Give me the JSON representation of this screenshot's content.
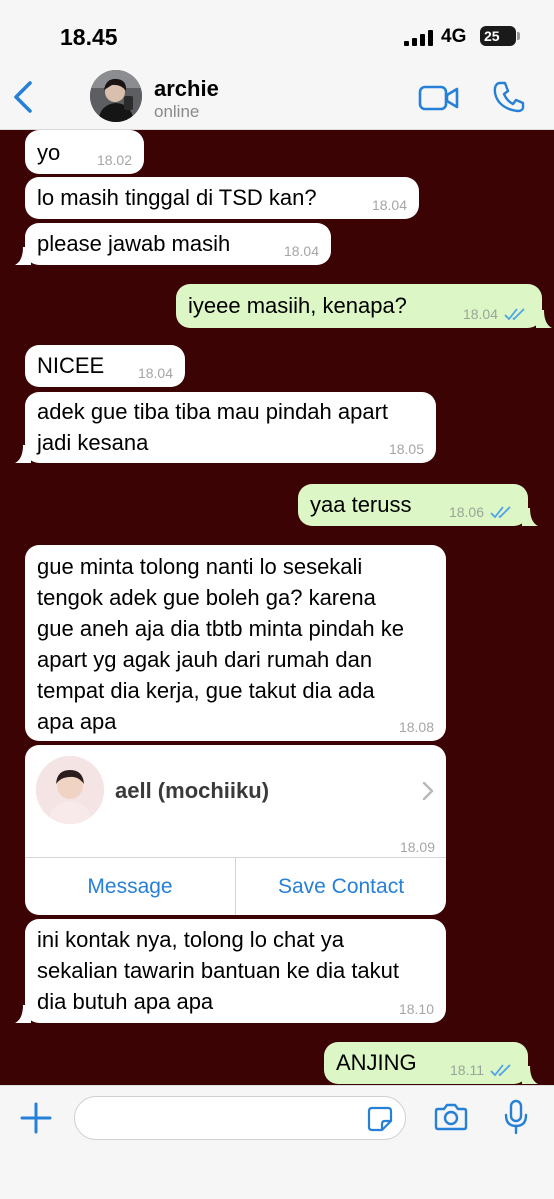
{
  "status_bar": {
    "time": "18.45",
    "network": "4G",
    "battery": "25"
  },
  "header": {
    "back_icon": "chevron-left-icon",
    "name": "archie",
    "status": "online",
    "video_icon": "video-camera-icon",
    "phone_icon": "phone-icon"
  },
  "messages": [
    {
      "direction": "in",
      "text": "yo",
      "time": "18.02"
    },
    {
      "direction": "in",
      "text": "lo masih tinggal di TSD kan?",
      "time": "18.04"
    },
    {
      "direction": "in",
      "text": "please jawab masih",
      "time": "18.04"
    },
    {
      "direction": "out",
      "text": "iyeee masiih, kenapa?",
      "time": "18.04",
      "read": true
    },
    {
      "direction": "in",
      "text": "NICEE",
      "time": "18.04"
    },
    {
      "direction": "in",
      "lines": [
        "adek gue tiba tiba mau pindah apart",
        "jadi kesana"
      ],
      "time": "18.05"
    },
    {
      "direction": "out",
      "text": "yaa teruss",
      "time": "18.06",
      "read": true
    },
    {
      "direction": "in",
      "lines": [
        "gue minta tolong nanti lo sesekali",
        "tengok adek gue boleh ga? karena",
        "gue aneh aja dia tbtb minta pindah ke",
        "apart yg agak jauh dari rumah dan",
        "tempat dia kerja, gue takut dia ada",
        "apa apa"
      ],
      "time": "18.08"
    },
    {
      "direction": "in",
      "lines": [
        "ini kontak nya, tolong lo chat ya",
        "sekalian tawarin bantuan ke dia takut",
        "dia butuh apa apa"
      ],
      "time": "18.10"
    },
    {
      "direction": "out",
      "text": "ANJING",
      "time": "18.11",
      "read": true
    }
  ],
  "contact_card": {
    "name": "aell (mochiiku)",
    "time": "18.09",
    "message_label": "Message",
    "save_label": "Save Contact"
  },
  "input_bar": {
    "placeholder": "",
    "value": ""
  },
  "colors": {
    "chat_background": "#3b0303",
    "incoming_bubble": "#ffffff",
    "outgoing_bubble": "#dcf7c5",
    "accent": "#2780d8",
    "read_ticks": "#4fa3e8"
  }
}
